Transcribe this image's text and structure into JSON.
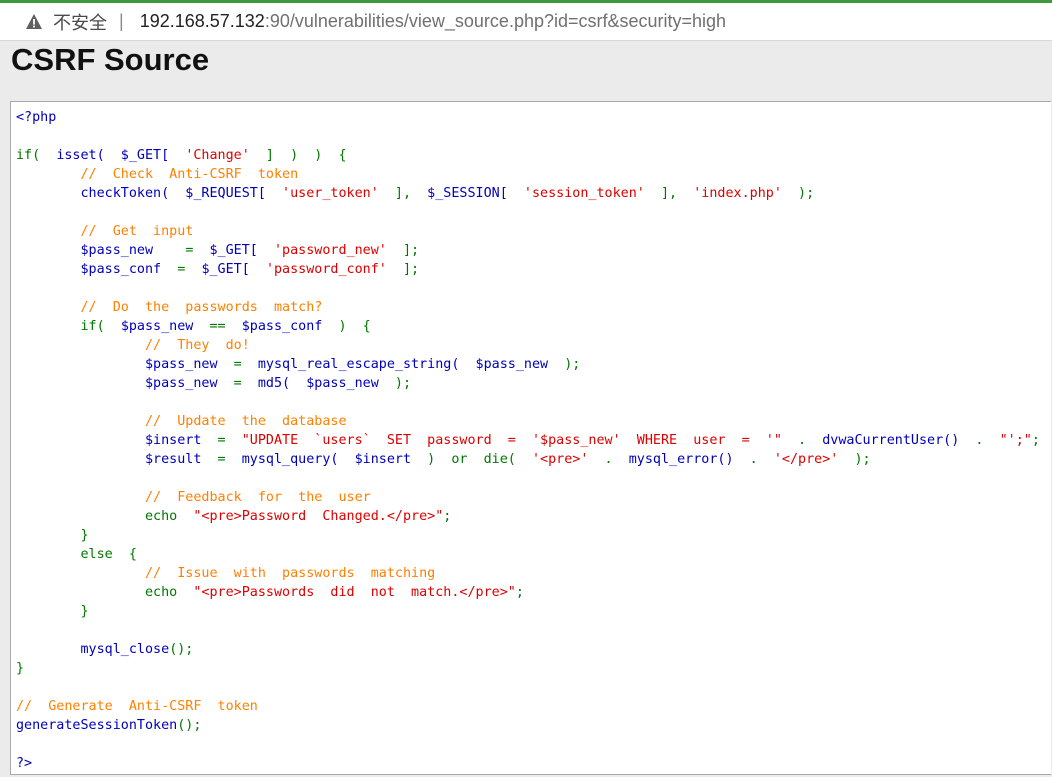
{
  "browser": {
    "security_label": "不安全",
    "separator": "|",
    "url_host": "192.168.57.132",
    "url_rest": ":90/vulnerabilities/view_source.php?id=csrf&security=high"
  },
  "page": {
    "title": "CSRF Source"
  },
  "colors": {
    "default": "#0000bb",
    "keyword": "#007700",
    "string": "#dd0000",
    "comment": "#ff8000"
  },
  "code_lines": [
    [
      [
        "default",
        "<?php"
      ]
    ],
    [],
    [
      [
        "keyword",
        "if(  "
      ],
      [
        "default",
        "isset(  $_GET[  "
      ],
      [
        "string",
        "'Change'"
      ],
      [
        "keyword",
        "  ]  )  )  {"
      ]
    ],
    [
      [
        "comment",
        "        //  Check  Anti-CSRF  token"
      ]
    ],
    [
      [
        "default",
        "        checkToken(  $_REQUEST[  "
      ],
      [
        "string",
        "'user_token'"
      ],
      [
        "keyword",
        "  ],  "
      ],
      [
        "default",
        "$_SESSION[  "
      ],
      [
        "string",
        "'session_token'"
      ],
      [
        "keyword",
        "  ],  "
      ],
      [
        "string",
        "'index.php'"
      ],
      [
        "keyword",
        "  );"
      ]
    ],
    [],
    [
      [
        "comment",
        "        //  Get  input"
      ]
    ],
    [
      [
        "default",
        "        $pass_new    "
      ],
      [
        "keyword",
        "=  "
      ],
      [
        "default",
        "$_GET[  "
      ],
      [
        "string",
        "'password_new'"
      ],
      [
        "keyword",
        "  ];"
      ]
    ],
    [
      [
        "default",
        "        $pass_conf  "
      ],
      [
        "keyword",
        "=  "
      ],
      [
        "default",
        "$_GET[  "
      ],
      [
        "string",
        "'password_conf'"
      ],
      [
        "keyword",
        "  ];"
      ]
    ],
    [],
    [
      [
        "comment",
        "        //  Do  the  passwords  match?"
      ]
    ],
    [
      [
        "keyword",
        "        if(  "
      ],
      [
        "default",
        "$pass_new  "
      ],
      [
        "keyword",
        "==  "
      ],
      [
        "default",
        "$pass_conf  "
      ],
      [
        "keyword",
        ")  {"
      ]
    ],
    [
      [
        "comment",
        "                //  They  do!"
      ]
    ],
    [
      [
        "default",
        "                $pass_new  "
      ],
      [
        "keyword",
        "=  "
      ],
      [
        "default",
        "mysql_real_escape_string(  $pass_new  "
      ],
      [
        "keyword",
        ");"
      ]
    ],
    [
      [
        "default",
        "                $pass_new  "
      ],
      [
        "keyword",
        "=  "
      ],
      [
        "default",
        "md5(  $pass_new  "
      ],
      [
        "keyword",
        ");"
      ]
    ],
    [],
    [
      [
        "comment",
        "                //  Update  the  database"
      ]
    ],
    [
      [
        "default",
        "                $insert  "
      ],
      [
        "keyword",
        "=  "
      ],
      [
        "string",
        "\"UPDATE  `users`  SET  password  =  '$pass_new'  WHERE  user  =  '\""
      ],
      [
        "keyword",
        "  .  "
      ],
      [
        "default",
        "dvwaCurrentUser()  "
      ],
      [
        "keyword",
        ".  "
      ],
      [
        "string",
        "\"';\""
      ],
      [
        "keyword",
        ";"
      ]
    ],
    [
      [
        "default",
        "                $result  "
      ],
      [
        "keyword",
        "=  "
      ],
      [
        "default",
        "mysql_query(  $insert  "
      ],
      [
        "keyword",
        ")  or  die(  "
      ],
      [
        "string",
        "'<pre>'"
      ],
      [
        "keyword",
        "  .  "
      ],
      [
        "default",
        "mysql_error()  "
      ],
      [
        "keyword",
        ".  "
      ],
      [
        "string",
        "'</pre>'"
      ],
      [
        "keyword",
        "  );"
      ]
    ],
    [],
    [
      [
        "comment",
        "                //  Feedback  for  the  user"
      ]
    ],
    [
      [
        "keyword",
        "                echo  "
      ],
      [
        "string",
        "\"<pre>Password  Changed.</pre>\""
      ],
      [
        "keyword",
        ";"
      ]
    ],
    [
      [
        "keyword",
        "        }"
      ]
    ],
    [
      [
        "keyword",
        "        else  {"
      ]
    ],
    [
      [
        "comment",
        "                //  Issue  with  passwords  matching"
      ]
    ],
    [
      [
        "keyword",
        "                echo  "
      ],
      [
        "string",
        "\"<pre>Passwords  did  not  match.</pre>\""
      ],
      [
        "keyword",
        ";"
      ]
    ],
    [
      [
        "keyword",
        "        }"
      ]
    ],
    [],
    [
      [
        "default",
        "        mysql_close"
      ],
      [
        "keyword",
        "();"
      ]
    ],
    [
      [
        "keyword",
        "}"
      ]
    ],
    [],
    [
      [
        "comment",
        "//  Generate  Anti-CSRF  token"
      ]
    ],
    [
      [
        "default",
        "generateSessionToken"
      ],
      [
        "keyword",
        "();"
      ]
    ],
    [],
    [
      [
        "default",
        "?>"
      ]
    ]
  ]
}
